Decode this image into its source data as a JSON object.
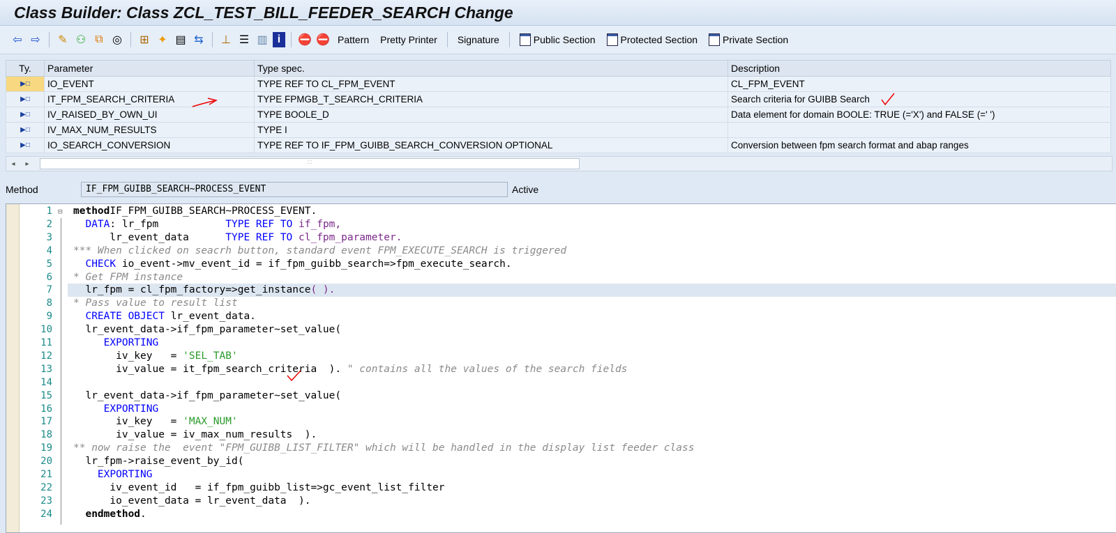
{
  "title": "Class Builder: Class ZCL_TEST_BILL_FEEDER_SEARCH Change",
  "toolbar": {
    "pattern": "Pattern",
    "pretty_printer": "Pretty Printer",
    "signature": "Signature",
    "public_section": "Public Section",
    "protected_section": "Protected Section",
    "private_section": "Private Section"
  },
  "params": {
    "headers": [
      "Ty.",
      "Parameter",
      "Type spec.",
      "Description"
    ],
    "rows": [
      {
        "parameter": "IO_EVENT",
        "type": "TYPE REF TO CL_FPM_EVENT",
        "description": "CL_FPM_EVENT"
      },
      {
        "parameter": "IT_FPM_SEARCH_CRITERIA",
        "type": "TYPE FPMGB_T_SEARCH_CRITERIA",
        "description": "Search criteria for GUIBB Search"
      },
      {
        "parameter": "IV_RAISED_BY_OWN_UI",
        "type": "TYPE BOOLE_D",
        "description": "Data element for domain BOOLE: TRUE (='X') and FALSE (=' ')"
      },
      {
        "parameter": "IV_MAX_NUM_RESULTS",
        "type": "TYPE I",
        "description": ""
      },
      {
        "parameter": "IO_SEARCH_CONVERSION",
        "type": "TYPE REF TO IF_FPM_GUIBB_SEARCH_CONVERSION OPTIONAL",
        "description": "Conversion between fpm search format and abap ranges"
      }
    ]
  },
  "method": {
    "label": "Method",
    "value": "IF_FPM_GUIBB_SEARCH~PROCESS_EVENT",
    "status": "Active"
  },
  "code": [
    [
      [
        "b",
        "method"
      ],
      [
        "",
        "IF_FPM_GUIBB_SEARCH~PROCESS_EVENT."
      ]
    ],
    [
      [
        "",
        "  "
      ],
      [
        "kw",
        "DATA"
      ],
      [
        "",
        ": lr_fpm           "
      ],
      [
        "kw",
        "TYPE REF TO"
      ],
      [
        "op",
        " if_fpm,"
      ]
    ],
    [
      [
        "",
        "      lr_event_data      "
      ],
      [
        "kw",
        "TYPE REF TO"
      ],
      [
        "",
        ""
      ],
      [
        "op",
        " cl_fpm_parameter."
      ]
    ],
    [
      [
        "cm",
        "*** When clicked on seacrh button, standard event FPM_EXECUTE_SEARCH is triggered"
      ]
    ],
    [
      [
        "",
        "  "
      ],
      [
        "kw",
        "CHECK"
      ],
      [
        "",
        " io_event->mv_event_id = if_fpm_guibb_search=>fpm_execute_search."
      ]
    ],
    [
      [
        "cm",
        "* Get FPM instance"
      ]
    ],
    [
      [
        "",
        "  lr_fpm = cl_fpm_factory=>get_instance"
      ],
      [
        "op",
        "( )."
      ]
    ],
    [
      [
        "cm",
        "* Pass value to result list"
      ]
    ],
    [
      [
        "",
        "  "
      ],
      [
        "kw",
        "CREATE OBJECT"
      ],
      [
        "",
        " lr_event_data."
      ]
    ],
    [
      [
        "",
        "  lr_event_data->if_fpm_parameter~set_value("
      ]
    ],
    [
      [
        "",
        "     "
      ],
      [
        "kw",
        "EXPORTING"
      ]
    ],
    [
      [
        "",
        "       iv_key   = "
      ],
      [
        "st",
        "'SEL_TAB'"
      ]
    ],
    [
      [
        "",
        "       iv_value = it_fpm_search_criteria  ). "
      ],
      [
        "cm",
        "\" contains all the values of the search fields"
      ]
    ],
    [
      [
        "",
        ""
      ]
    ],
    [
      [
        "",
        "  lr_event_data->if_fpm_parameter~set_value("
      ]
    ],
    [
      [
        "",
        "     "
      ],
      [
        "kw",
        "EXPORTING"
      ]
    ],
    [
      [
        "",
        "       iv_key   = "
      ],
      [
        "st",
        "'MAX_NUM'"
      ]
    ],
    [
      [
        "",
        "       iv_value = iv_max_num_results  )."
      ]
    ],
    [
      [
        "cm",
        "** now raise the  event \"FPM_GUIBB_LIST_FILTER\" which will be handled in the display list feeder class"
      ]
    ],
    [
      [
        "",
        "  lr_fpm->raise_event_by_id("
      ]
    ],
    [
      [
        "",
        "    "
      ],
      [
        "kw",
        "EXPORTING"
      ]
    ],
    [
      [
        "",
        "      iv_event_id   = if_fpm_guibb_list=>gc_event_list_filter"
      ]
    ],
    [
      [
        "",
        "      io_event_data = lr_event_data  )."
      ]
    ],
    [
      [
        "",
        "  "
      ],
      [
        "b",
        "endmethod"
      ],
      [
        "",
        "."
      ]
    ]
  ]
}
